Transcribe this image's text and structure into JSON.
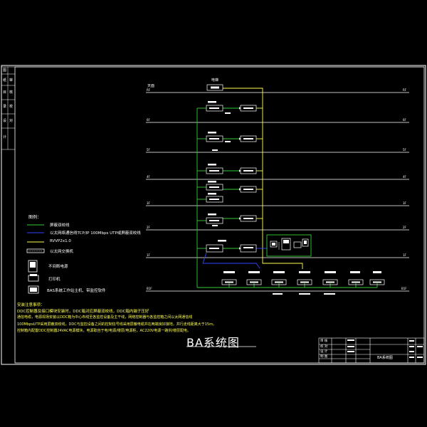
{
  "diagram": {
    "title": "BA系统图",
    "top_level_label": "天面",
    "top_device": "电梯",
    "legend": {
      "heading": "图例：",
      "items": [
        {
          "label": "屏蔽双绞线"
        },
        {
          "label": "以太网络通信线TCP/IP 100Mbps UTP或屏蔽双绞线"
        },
        {
          "label": "RVVP2x1.0"
        },
        {
          "label": "以太网交换机"
        },
        {
          "label": "不间断电源"
        },
        {
          "label": "打印机"
        },
        {
          "label": "BAS系统工作站主机、带监控软件"
        }
      ]
    },
    "notes": [
      "安装注意事项：",
      "DDC控制器及接口模块安装时，DDC箱对应屏蔽双绞线，DDC箱内端子压好",
      "通信电缆，电源现场安装以DDC箱为中心布线至各监控设备及主干线，网络控制器与各监控箱之间以太网通信线",
      "100MbpsUTP采用屏蔽双绞线，DDC与监控设备之间的控制信号线采用屏蔽电缆并在两端良好接地，并行走线距离大于15m。",
      "控制箱内配置DDC控制器24VAC电源模块，电源取自于电/电源/楼层/电源柜，AC220V电源一路供/楼层配电。"
    ],
    "left_column_labels": [
      "图",
      "纸",
      "目",
      "录",
      "设",
      "计",
      "审",
      "核",
      "校",
      "对"
    ],
    "title_block": {
      "project": "BA系统图",
      "rows": [
        "审 核",
        "校 对",
        "设 计",
        "制 图"
      ]
    }
  }
}
